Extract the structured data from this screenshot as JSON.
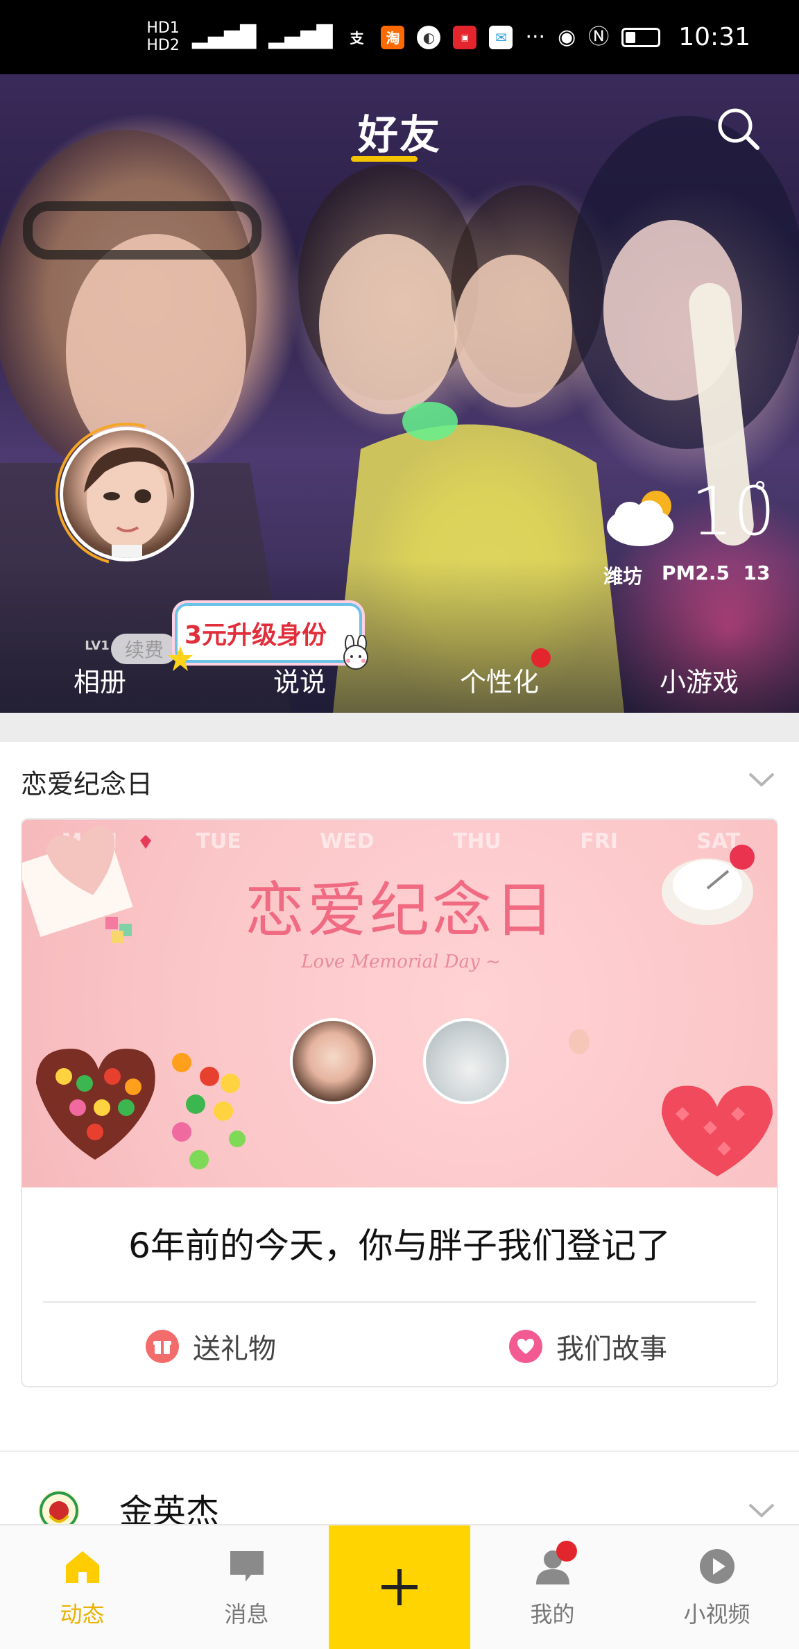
{
  "status_bar": {
    "time": "10:31",
    "network": [
      "HD1",
      "HD2",
      "4G",
      "4G"
    ],
    "app_icons": [
      "alipay-icon",
      "taobao-icon",
      "browser-icon",
      "huawei-icon",
      "message-icon"
    ],
    "overflow": "···"
  },
  "hero": {
    "title": "好友",
    "vip_level": "LV1",
    "renew_label": "续费",
    "upgrade_label": "3元升级身份",
    "weather": {
      "temperature": "10",
      "degree_symbol": "°",
      "city": "潍坊",
      "pm_label": "PM2.5",
      "pm_value": "13"
    },
    "nav": [
      {
        "label": "相册"
      },
      {
        "label": "说说"
      },
      {
        "label": "个性化"
      },
      {
        "label": "小游戏"
      }
    ]
  },
  "anniversary": {
    "section_title": "恋爱纪念日",
    "banner_title": "恋爱纪念日",
    "banner_subtitle": "Love Memorial Day ~",
    "weekdays": [
      "MON",
      "TUE",
      "WED",
      "THU",
      "FRI",
      "SAT"
    ],
    "message": "6年前的今天，你与胖子我们登记了",
    "actions": [
      {
        "label": "送礼物",
        "icon": "gift-icon"
      },
      {
        "label": "我们故事",
        "icon": "heart-icon"
      }
    ]
  },
  "next_post": {
    "name": "金英杰"
  },
  "tabbar": {
    "items": [
      {
        "label": "动态",
        "icon": "home-icon"
      },
      {
        "label": "消息",
        "icon": "chat-icon"
      },
      {
        "label": "",
        "icon": "plus-icon"
      },
      {
        "label": "我的",
        "icon": "user-icon"
      },
      {
        "label": "小视频",
        "icon": "play-icon"
      }
    ]
  },
  "colors": {
    "accent": "#ffd400",
    "active_tab": "#e9b200",
    "badge": "#e3262e"
  }
}
